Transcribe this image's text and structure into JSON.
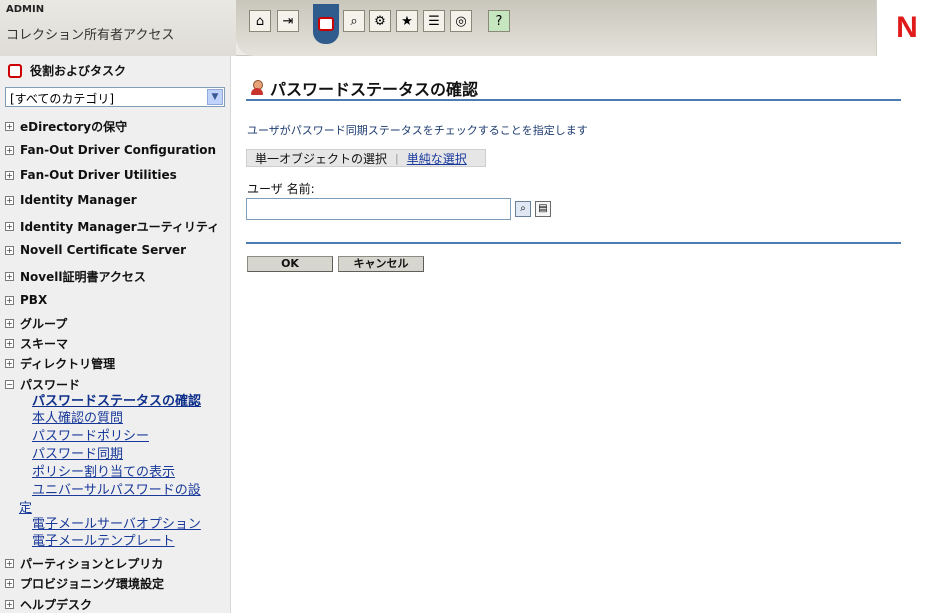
{
  "header": {
    "user": "ADMIN",
    "role": "コレクション所有者アクセス",
    "toolbar_icons": [
      "home-icon",
      "exit-icon",
      "roles-tasks-icon",
      "view-objects-icon",
      "configure-icon",
      "favorites-icon",
      "task-list-icon",
      "identity-icon",
      "help-icon"
    ],
    "logo": "N",
    "brand_color": "#e01a1a"
  },
  "nav": {
    "title": "役割およびタスク",
    "category_select": "[すべてのカテゴリ]",
    "categories": [
      {
        "label": "eDirectoryの保守",
        "expanded": false
      },
      {
        "label": "Fan-Out Driver Configuration",
        "expanded": false
      },
      {
        "label": "Fan-Out Driver Utilities",
        "expanded": false
      },
      {
        "label": "Identity Manager",
        "expanded": false
      },
      {
        "label": "Identity Managerユーティリティ",
        "expanded": false
      },
      {
        "label": "Novell Certificate Server",
        "expanded": false
      },
      {
        "label": "Novell証明書アクセス",
        "expanded": false
      },
      {
        "label": "PBX",
        "expanded": false
      },
      {
        "label": "グループ",
        "expanded": false
      },
      {
        "label": "スキーマ",
        "expanded": false
      },
      {
        "label": "ディレクトリ管理",
        "expanded": false
      },
      {
        "label": "パスワード",
        "expanded": true
      },
      {
        "label": "パーティションとレプリカ",
        "expanded": false
      },
      {
        "label": "プロビジョニング環境設定",
        "expanded": false
      },
      {
        "label": "ヘルプデスク",
        "expanded": false
      }
    ],
    "password_tasks": [
      "パスワードステータスの確認",
      "本人確認の質問",
      "パスワードポリシー",
      "パスワード同期",
      "ポリシー割り当ての表示",
      "ユニバーサルパスワードの設",
      "定",
      "電子メールサーバオプション",
      "電子メールテンプレート"
    ],
    "current_task": "パスワードステータスの確認"
  },
  "main": {
    "title": "パスワードステータスの確認",
    "description": "ユーザがパスワード同期ステータスをチェックすることを指定します",
    "mode_current": "単一オブジェクトの選択",
    "mode_separator": "|",
    "mode_link": "単純な選択",
    "field_label": "ユーザ 名前:",
    "field_value": "",
    "ok_label": "OK",
    "cancel_label": "キャンセル",
    "accent_color": "#4b7db0"
  }
}
